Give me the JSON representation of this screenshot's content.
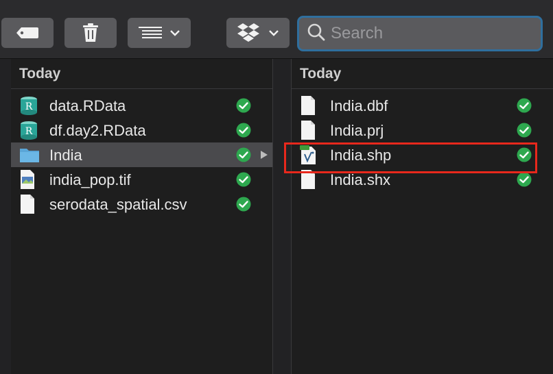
{
  "toolbar": {
    "buttons": [
      {
        "icon": "tag-icon"
      },
      {
        "icon": "trash-icon"
      },
      {
        "icon": "list-view-icon"
      },
      {
        "icon": "dropbox-icon"
      }
    ],
    "search": {
      "placeholder": "Search",
      "value": ""
    }
  },
  "left_column": {
    "header": "Today",
    "items": [
      {
        "name": "data.RData",
        "icon": "rdata-file-icon",
        "synced": true,
        "selected": false
      },
      {
        "name": "df.day2.RData",
        "icon": "rdata-file-icon",
        "synced": true,
        "selected": false
      },
      {
        "name": "India",
        "icon": "folder-icon",
        "synced": true,
        "selected": true
      },
      {
        "name": "india_pop.tif",
        "icon": "image-file-icon",
        "synced": true,
        "selected": false
      },
      {
        "name": "serodata_spatial.csv",
        "icon": "document-icon",
        "synced": true,
        "selected": false
      }
    ]
  },
  "right_column": {
    "header": "Today",
    "items": [
      {
        "name": "India.dbf",
        "icon": "document-icon",
        "synced": true
      },
      {
        "name": "India.prj",
        "icon": "document-icon",
        "synced": true
      },
      {
        "name": "India.shp",
        "icon": "shapefile-icon",
        "synced": true,
        "highlighted": true
      },
      {
        "name": "India.shx",
        "icon": "document-icon",
        "synced": true
      }
    ]
  },
  "colors": {
    "accent": "#2f6f9e",
    "highlight": "#e8281c",
    "synced": "#2ea84f"
  }
}
